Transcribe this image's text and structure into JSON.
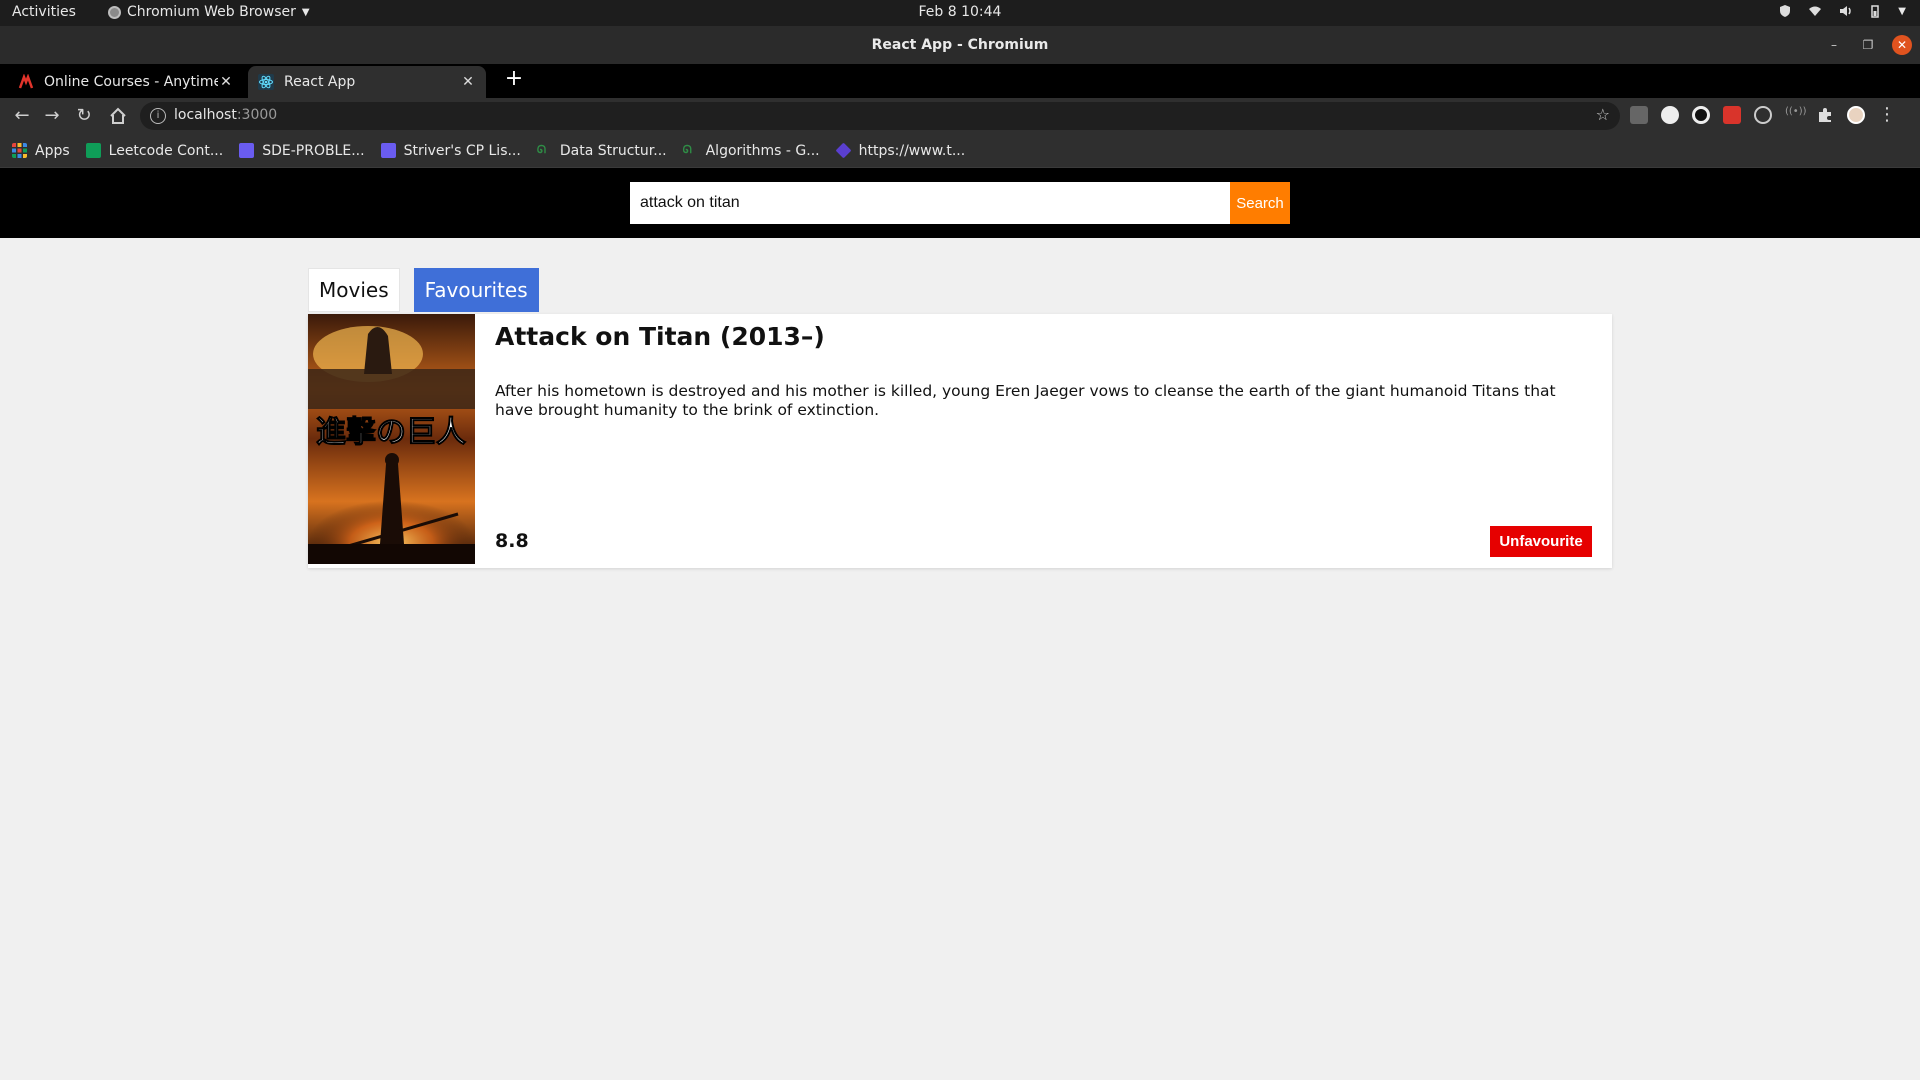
{
  "os": {
    "activities": "Activities",
    "app_menu": "Chromium Web Browser",
    "clock": "Feb 8  10:44"
  },
  "window": {
    "title": "React App - Chromium"
  },
  "browser": {
    "tabs": [
      {
        "label": "Online Courses - Anytime, Anywhere",
        "icon": "udemy-favicon-icon",
        "active": false
      },
      {
        "label": "React App",
        "icon": "react-favicon-icon",
        "active": true
      }
    ],
    "address": {
      "host": "localhost",
      "port": ":3000"
    },
    "bookmarks": [
      {
        "label": "Apps",
        "icon": "apps-grid-icon",
        "color": "#e8453c"
      },
      {
        "label": "Leetcode Cont...",
        "icon": "sheets-icon",
        "color": "#0f9d58"
      },
      {
        "label": "SDE-PROBLE...",
        "icon": "docs-icon",
        "color": "#6a5cf0"
      },
      {
        "label": "Striver's CP Lis...",
        "icon": "docs-icon",
        "color": "#6a5cf0"
      },
      {
        "label": "Data Structur...",
        "icon": "gfg-icon",
        "color": "#2f8d46"
      },
      {
        "label": "Algorithms - G...",
        "icon": "gfg-icon",
        "color": "#2f8d46"
      },
      {
        "label": "https://www.t...",
        "icon": "diamond-icon",
        "color": "#5a3fd0"
      }
    ]
  },
  "app": {
    "search": {
      "value": "attack on titan",
      "button_label": "Search"
    },
    "tabs": [
      {
        "label": "Movies",
        "active": false
      },
      {
        "label": "Favourites",
        "active": true
      }
    ],
    "movie": {
      "title": "Attack on Titan (2013–)",
      "plot": "After his hometown is destroyed and his mother is killed, young Eren Jaeger vows to cleanse the earth of the giant humanoid Titans that have brought humanity to the brink of extinction.",
      "rating": "8.8",
      "poster_text": "進撃の巨人",
      "action_label": "Unfavourite"
    },
    "colors": {
      "search_button": "#ff7d00",
      "favourites_tab": "#3f6fd8",
      "unfavourite_button": "#e60000"
    }
  }
}
